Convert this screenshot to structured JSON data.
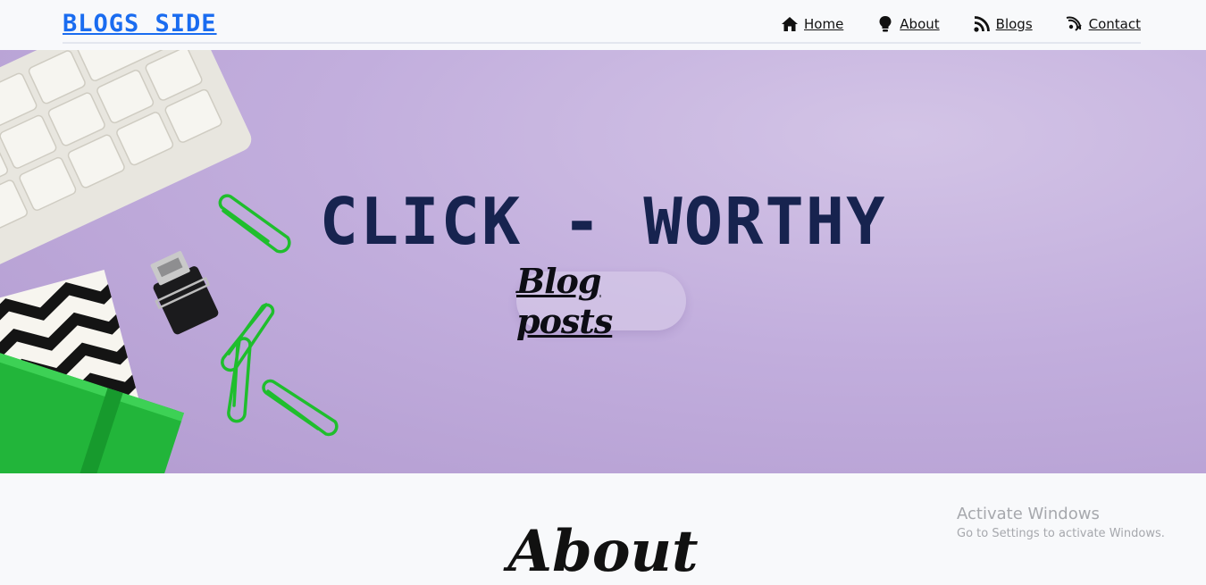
{
  "brand": "BLOGS SIDE",
  "nav": {
    "items": [
      {
        "label": "Home",
        "icon": "home-icon"
      },
      {
        "label": "About",
        "icon": "lightbulb-icon"
      },
      {
        "label": "Blogs",
        "icon": "rss-icon"
      },
      {
        "label": "Contact",
        "icon": "signal-icon"
      }
    ]
  },
  "hero": {
    "title": "CLICK - WORTHY",
    "button_label": "Blog posts"
  },
  "about": {
    "title": "About"
  },
  "watermark": {
    "title": "Activate Windows",
    "subtitle": "Go to Settings to activate Windows."
  },
  "colors": {
    "brand": "#1a6cf0",
    "hero_bg": "#c2aedd",
    "hero_title": "#17234f"
  }
}
